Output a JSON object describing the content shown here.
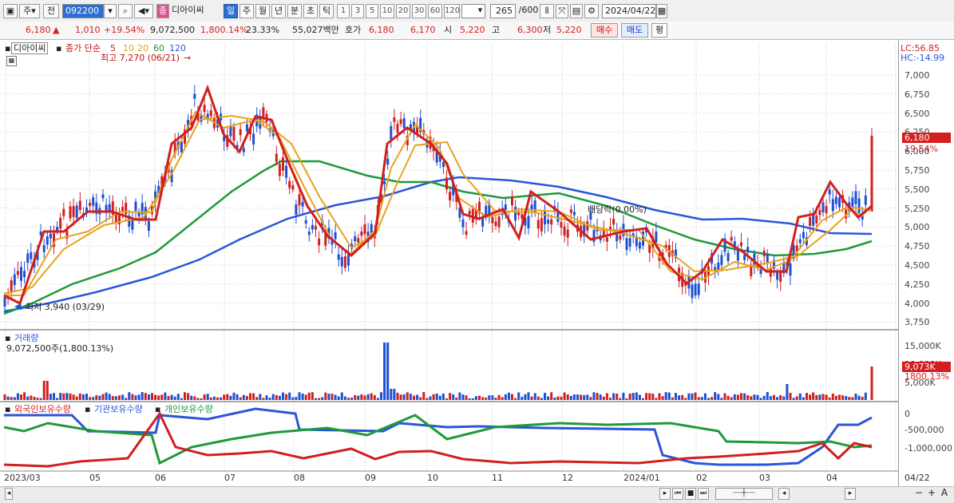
{
  "toolbar": {
    "type_label": "주",
    "market_label": "전",
    "code": "092200",
    "stock_badge": "종",
    "stock_name": "디아이씨",
    "periods": [
      "일",
      "주",
      "월",
      "년",
      "분",
      "초",
      "틱"
    ],
    "active_period": "일",
    "numbers": [
      "1",
      "3",
      "5",
      "10",
      "20",
      "30",
      "60",
      "120"
    ],
    "count_value": "265",
    "count_total": "/600",
    "date": "2024/04/22"
  },
  "quote": {
    "price": "6,180",
    "change_arrow": "▲",
    "change": "1,010",
    "change_pct": "+19.54%",
    "volume": "9,072,500",
    "volume_pct": "1,800.14%",
    "turnover": "23.33%",
    "amount": "55,027백만",
    "hoga_label": "호가",
    "ask": "6,180",
    "bid": "6,170",
    "open_label": "시",
    "open": "5,220",
    "high_label": "고",
    "high": "6,300",
    "low_label": "저",
    "low": "5,220",
    "buy_label": "매수",
    "sell_label": "매도",
    "avg_label": "평"
  },
  "legend": {
    "stock": "디아이씨",
    "ma_title": "종가 단순",
    "ma_values": [
      "5",
      "10",
      "20",
      "60",
      "120"
    ],
    "high_mark": "최고 7,270 (06/21)",
    "low_mark": "최저 3,940 (03/29)",
    "dividend_mark": "배당락(0.00%)"
  },
  "right_panel": {
    "lc": "LC:56.85",
    "hc": "HC:-14.99",
    "price_ticks": [
      "7,000",
      "6,750",
      "6,500",
      "6,250",
      "6,000",
      "5,750",
      "5,500",
      "5,250",
      "5,000",
      "4,750",
      "4,500",
      "4,250",
      "4,000",
      "3,750"
    ],
    "current_price": "6,180",
    "current_pct": "19.54%",
    "vol_ticks": [
      "15,000K",
      "10,000K",
      "5,000K"
    ],
    "vol_current": "9,073K",
    "vol_pct": "1800.13%",
    "hold_ticks": [
      "0",
      "-500,000",
      "-1,000,000"
    ]
  },
  "volume_panel": {
    "title": "거래량",
    "value": "9,072,500주(1,800.13%)"
  },
  "holdings_panel": {
    "foreign": "외국인보유수량",
    "institution": "기관보유수량",
    "individual": "개인보유수량"
  },
  "x_labels": [
    "2023/03",
    "05",
    "06",
    "07",
    "08",
    "09",
    "10",
    "11",
    "12",
    "2024/01",
    "02",
    "03",
    "04",
    "04/22"
  ],
  "colors": {
    "up": "#d21f1f",
    "down": "#1f4fd2",
    "ma5": "#d21f1f",
    "ma10": "#e8a21c",
    "ma20": "#e8a21c",
    "ma60": "#1e9a3a",
    "ma120": "#2b55d9"
  }
}
